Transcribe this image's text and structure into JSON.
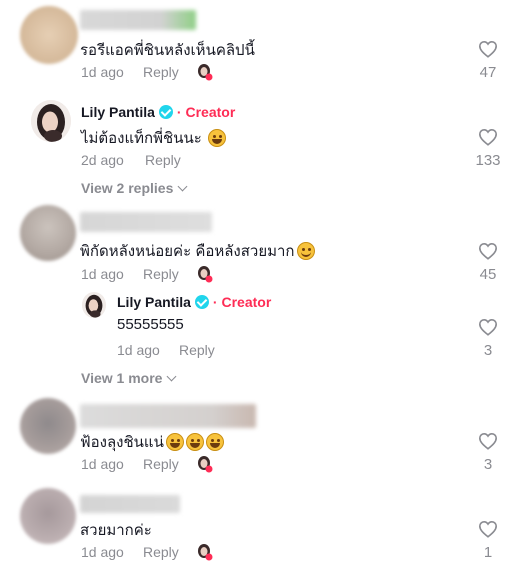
{
  "comments": [
    {
      "text": "รอรีแอคพี่ชินหลังเห็นคลิปนี้",
      "time": "1d ago",
      "reply_label": "Reply",
      "likes": "47"
    },
    {
      "user": "Lily Pantila",
      "creator_label": "· Creator",
      "text": "ไม่ต้องแท็กพี่ชินนะ",
      "emoji": "grin",
      "time": "2d ago",
      "reply_label": "Reply",
      "likes": "133",
      "view_replies": "View 2 replies"
    },
    {
      "text": "พิกัดหลังหน่อยค่ะ คือหลังสวยมาก",
      "emoji": "smile",
      "time": "1d ago",
      "reply_label": "Reply",
      "likes": "45",
      "reply": {
        "user": "Lily Pantila",
        "creator_label": "· Creator",
        "text": "55555555",
        "time": "1d ago",
        "reply_label": "Reply",
        "likes": "3"
      },
      "view_more": "View 1 more"
    },
    {
      "text": "ฟ้องลุงชินแน่",
      "emoji": "grin",
      "time": "1d ago",
      "reply_label": "Reply",
      "likes": "3"
    },
    {
      "text": "สวยมากค่ะ",
      "time": "1d ago",
      "reply_label": "Reply",
      "likes": "1"
    }
  ],
  "colors": {
    "creator_accent": "#fe2c55",
    "verified": "#20d5ec",
    "meta_gray": "#8a8b91"
  },
  "icons": [
    "heart-icon",
    "verified-icon",
    "chevron-down-icon",
    "creator-liked-avatar-icon"
  ]
}
